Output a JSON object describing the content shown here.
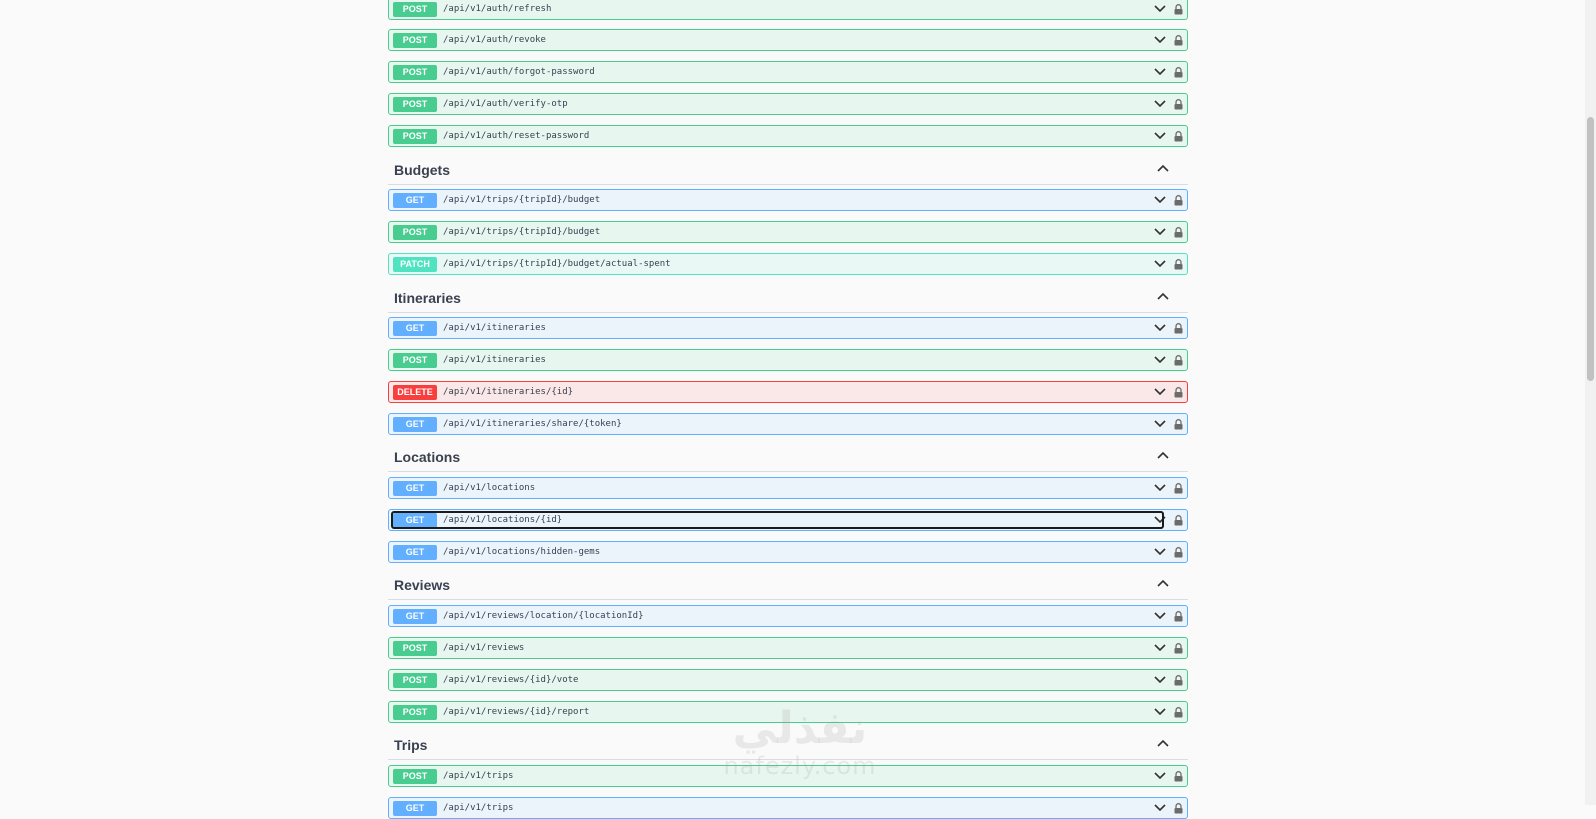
{
  "colors": {
    "post": "#49cc90",
    "get": "#61affe",
    "patch": "#50e3c2",
    "delete": "#f93e3e",
    "text": "#3b4151"
  },
  "items": [
    {
      "kind": "op",
      "method": "POST",
      "path": "/api/v1/auth/refresh"
    },
    {
      "kind": "op",
      "method": "POST",
      "path": "/api/v1/auth/revoke"
    },
    {
      "kind": "op",
      "method": "POST",
      "path": "/api/v1/auth/forgot-password"
    },
    {
      "kind": "op",
      "method": "POST",
      "path": "/api/v1/auth/verify-otp"
    },
    {
      "kind": "op",
      "method": "POST",
      "path": "/api/v1/auth/reset-password"
    },
    {
      "kind": "tag",
      "name": "Budgets"
    },
    {
      "kind": "op",
      "method": "GET",
      "path": "/api/v1/trips/{tripId}/budget"
    },
    {
      "kind": "op",
      "method": "POST",
      "path": "/api/v1/trips/{tripId}/budget"
    },
    {
      "kind": "op",
      "method": "PATCH",
      "path": "/api/v1/trips/{tripId}/budget/actual-spent"
    },
    {
      "kind": "tag",
      "name": "Itineraries"
    },
    {
      "kind": "op",
      "method": "GET",
      "path": "/api/v1/itineraries"
    },
    {
      "kind": "op",
      "method": "POST",
      "path": "/api/v1/itineraries"
    },
    {
      "kind": "op",
      "method": "DELETE",
      "path": "/api/v1/itineraries/{id}"
    },
    {
      "kind": "op",
      "method": "GET",
      "path": "/api/v1/itineraries/share/{token}"
    },
    {
      "kind": "tag",
      "name": "Locations"
    },
    {
      "kind": "op",
      "method": "GET",
      "path": "/api/v1/locations"
    },
    {
      "kind": "op",
      "method": "GET",
      "path": "/api/v1/locations/{id}",
      "focused": true
    },
    {
      "kind": "op",
      "method": "GET",
      "path": "/api/v1/locations/hidden-gems"
    },
    {
      "kind": "tag",
      "name": "Reviews"
    },
    {
      "kind": "op",
      "method": "GET",
      "path": "/api/v1/reviews/location/{locationId}"
    },
    {
      "kind": "op",
      "method": "POST",
      "path": "/api/v1/reviews"
    },
    {
      "kind": "op",
      "method": "POST",
      "path": "/api/v1/reviews/{id}/vote"
    },
    {
      "kind": "op",
      "method": "POST",
      "path": "/api/v1/reviews/{id}/report"
    },
    {
      "kind": "tag",
      "name": "Trips"
    },
    {
      "kind": "op",
      "method": "POST",
      "path": "/api/v1/trips"
    },
    {
      "kind": "op",
      "method": "GET",
      "path": "/api/v1/trips"
    }
  ],
  "watermark": {
    "logo": "نفذلي",
    "url": "nafezly.com"
  }
}
